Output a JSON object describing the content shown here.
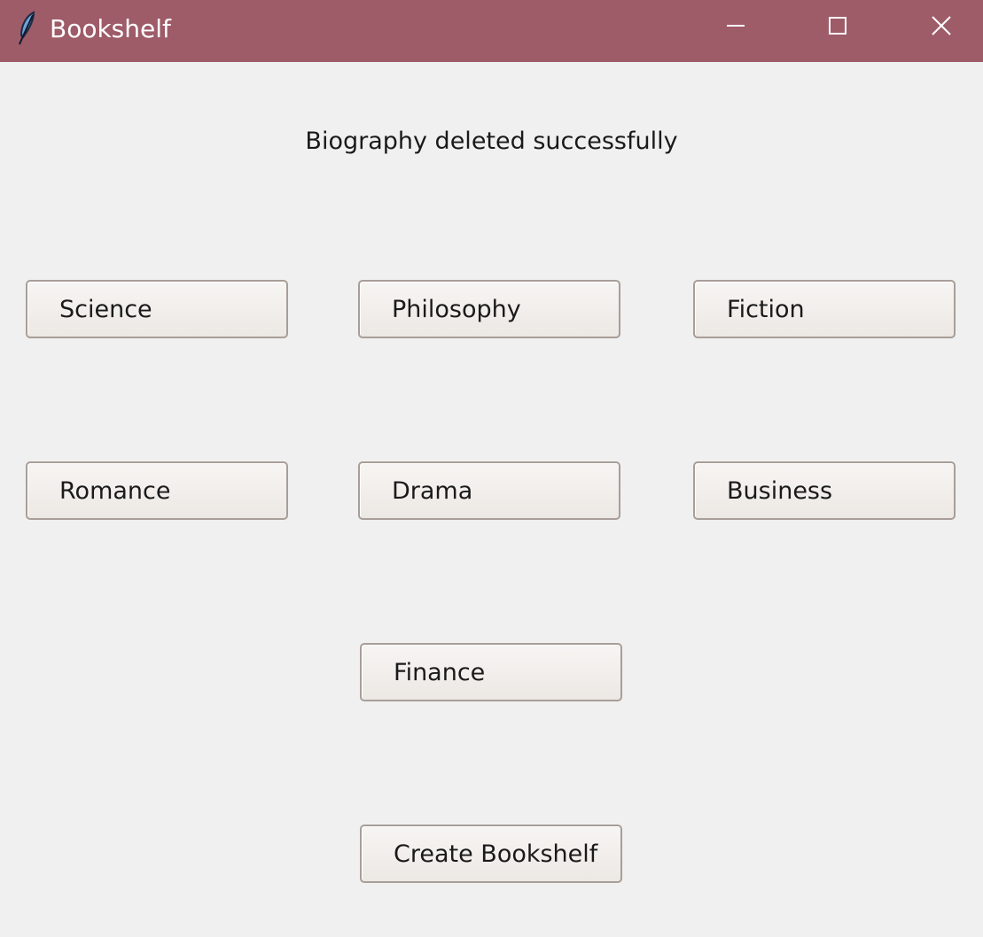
{
  "window": {
    "title": "Bookshelf",
    "icon": "feather-icon",
    "controls": [
      "minimize-icon",
      "maximize-icon",
      "close-icon"
    ]
  },
  "status": {
    "message": "Biography deleted successfully"
  },
  "categories": {
    "science": "Science",
    "philosophy": "Philosophy",
    "fiction": "Fiction",
    "romance": "Romance",
    "drama": "Drama",
    "business": "Business",
    "finance": "Finance"
  },
  "actions": {
    "create": "Create Bookshelf"
  },
  "colors": {
    "titlebar": "#9e5b68",
    "background": "#f0f0f0"
  }
}
